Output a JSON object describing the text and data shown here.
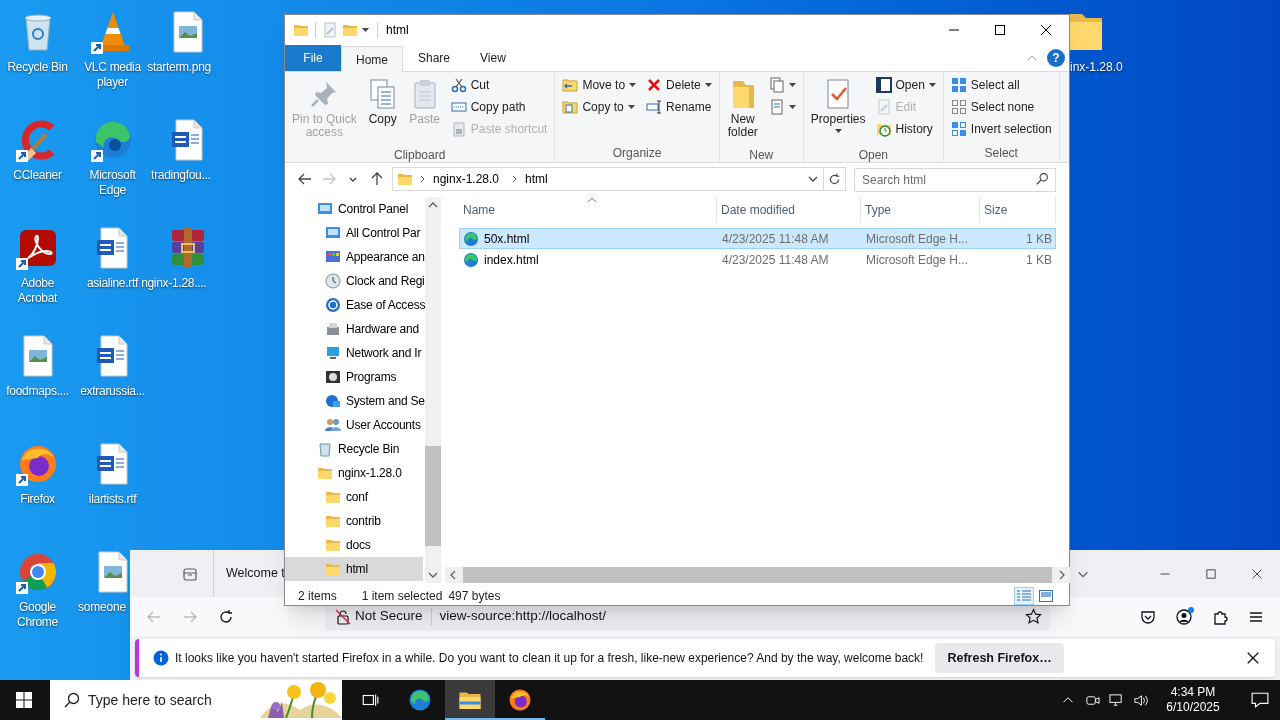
{
  "desktop": {
    "columns": [
      [
        {
          "label": "Recycle Bin",
          "kind": "recycle",
          "shortcut": false
        },
        {
          "label": "CCleaner",
          "kind": "ccleaner",
          "shortcut": true
        },
        {
          "label": "Adobe Acrobat",
          "kind": "acrobat",
          "shortcut": true
        },
        {
          "label": "foodmaps....",
          "kind": "image",
          "shortcut": false
        },
        {
          "label": "Firefox",
          "kind": "firefox",
          "shortcut": true
        },
        {
          "label": "Google Chrome",
          "kind": "chrome",
          "shortcut": true
        }
      ],
      [
        {
          "label": "VLC media player",
          "kind": "vlc",
          "shortcut": true
        },
        {
          "label": "Microsoft Edge",
          "kind": "edge",
          "shortcut": true
        },
        {
          "label": "asialine.rtf",
          "kind": "word",
          "shortcut": false
        },
        {
          "label": "extrarussia...",
          "kind": "word",
          "shortcut": false
        },
        {
          "label": "ilartists.rtf",
          "kind": "word",
          "shortcut": false
        },
        {
          "label": "someone",
          "kind": "image",
          "shortcut": false
        }
      ],
      [
        {
          "label": "starterm.png",
          "kind": "image",
          "shortcut": false
        },
        {
          "label": "tradingfou...",
          "kind": "word",
          "shortcut": false
        },
        {
          "label": "nginx-1.28....",
          "kind": "winrar",
          "shortcut": false
        }
      ]
    ],
    "edge_item": {
      "label": "inx-1.28.0",
      "kind": "folder",
      "shortcut": false
    }
  },
  "explorer": {
    "title": "html",
    "ribbon_tabs": [
      {
        "label": "File",
        "kind": "file",
        "selected": false
      },
      {
        "label": "Home",
        "kind": "tab",
        "selected": true
      },
      {
        "label": "Share",
        "kind": "tab",
        "selected": false
      },
      {
        "label": "View",
        "kind": "tab",
        "selected": false
      }
    ],
    "help": "?",
    "ribbon_groups": [
      {
        "label": "Clipboard",
        "items": [
          {
            "kind": "pin",
            "label": "Pin to Quick\naccess",
            "disabled": true,
            "dropdown": false
          },
          {
            "kind": "copy",
            "label": "Copy",
            "disabled": false,
            "dropdown": false
          },
          {
            "kind": "paste",
            "label": "Paste",
            "disabled": true,
            "dropdown": false
          },
          {
            "kind": "stack",
            "buttons": [
              {
                "label": "Cut",
                "kind": "cut",
                "disabled": false,
                "dropdown": false
              },
              {
                "label": "Copy path",
                "kind": "copypath",
                "disabled": false,
                "dropdown": false
              },
              {
                "label": "Paste shortcut",
                "kind": "pasteshortcut",
                "disabled": true,
                "dropdown": false
              }
            ]
          }
        ]
      },
      {
        "label": "Organize",
        "items": [
          {
            "kind": "stack",
            "buttons": [
              {
                "label": "Move to",
                "kind": "moveto",
                "disabled": false,
                "dropdown": true
              },
              {
                "label": "Copy to",
                "kind": "copyto",
                "disabled": false,
                "dropdown": true
              }
            ]
          },
          {
            "kind": "stack",
            "buttons": [
              {
                "label": "Delete",
                "kind": "delete",
                "disabled": false,
                "dropdown": true
              },
              {
                "label": "Rename",
                "kind": "rename",
                "disabled": false,
                "dropdown": false
              }
            ]
          }
        ]
      },
      {
        "label": "New",
        "items": [
          {
            "kind": "newfolder",
            "label": "New\nfolder",
            "disabled": false,
            "dropdown": false
          },
          {
            "kind": "stack",
            "buttons": [
              {
                "kind": "newitem",
                "disabled": false,
                "dropdown": true
              },
              {
                "kind": "easyaccess",
                "disabled": false,
                "dropdown": true
              }
            ]
          }
        ]
      },
      {
        "label": "Open",
        "items": [
          {
            "kind": "properties",
            "label": "Properties",
            "disabled": false,
            "dropdown": true
          },
          {
            "kind": "stack",
            "buttons": [
              {
                "label": "Open",
                "kind": "open",
                "disabled": false,
                "dropdown": true
              },
              {
                "label": "Edit",
                "kind": "edit",
                "disabled": true,
                "dropdown": false
              },
              {
                "label": "History",
                "kind": "history",
                "disabled": false,
                "dropdown": false
              }
            ]
          }
        ]
      },
      {
        "label": "Select",
        "items": [
          {
            "kind": "stack",
            "buttons": [
              {
                "label": "Select all",
                "kind": "selectall",
                "disabled": false,
                "dropdown": false
              },
              {
                "label": "Select none",
                "kind": "selectnone",
                "disabled": false,
                "dropdown": false
              },
              {
                "label": "Invert selection",
                "kind": "invert",
                "disabled": false,
                "dropdown": false
              }
            ]
          }
        ]
      }
    ],
    "nav_buttons": [
      {
        "kind": "back",
        "disabled": false
      },
      {
        "kind": "forward",
        "disabled": true
      },
      {
        "kind": "recent",
        "disabled": false
      },
      {
        "kind": "up",
        "disabled": false
      }
    ],
    "breadcrumb": [
      "nginx-1.28.0",
      "html"
    ],
    "search": {
      "placeholder": "Search html"
    },
    "nav_tree": [
      {
        "label": "Control Panel",
        "kind": "controlpanel",
        "selected": false,
        "children": [
          {
            "label": "All Control Par",
            "kind": "controlpanel",
            "selected": false
          },
          {
            "label": "Appearance an",
            "kind": "colors",
            "selected": false
          },
          {
            "label": "Clock and Regi",
            "kind": "clock",
            "selected": false
          },
          {
            "label": "Ease of Access",
            "kind": "ease",
            "selected": false
          },
          {
            "label": "Hardware and",
            "kind": "hardware",
            "selected": false
          },
          {
            "label": "Network and Ir",
            "kind": "network",
            "selected": false
          },
          {
            "label": "Programs",
            "kind": "programs",
            "selected": false
          },
          {
            "label": "System and Se",
            "kind": "system",
            "selected": false
          },
          {
            "label": "User Accounts",
            "kind": "users",
            "selected": false
          }
        ]
      },
      {
        "label": "Recycle Bin",
        "kind": "recycle",
        "selected": false
      },
      {
        "label": "nginx-1.28.0",
        "kind": "folder",
        "selected": false,
        "children": [
          {
            "label": "conf",
            "kind": "folder",
            "selected": false
          },
          {
            "label": "contrib",
            "kind": "folder",
            "selected": false
          },
          {
            "label": "docs",
            "kind": "folder",
            "selected": false
          },
          {
            "label": "html",
            "kind": "folder",
            "selected": true
          }
        ]
      }
    ],
    "columns": [
      {
        "label": "Name",
        "sorted": true
      },
      {
        "label": "Date modified",
        "sorted": false
      },
      {
        "label": "Type",
        "sorted": false
      },
      {
        "label": "Size",
        "sorted": false
      }
    ],
    "rows": [
      {
        "name": "50x.html",
        "date": "4/23/2025 11:48 AM",
        "type": "Microsoft Edge H...",
        "size": "1 KB",
        "selected": true
      },
      {
        "name": "index.html",
        "date": "4/23/2025 11:48 AM",
        "type": "Microsoft Edge H...",
        "size": "1 KB",
        "selected": false
      }
    ],
    "status_bar": {
      "items": "2 items",
      "selection": "1 item selected",
      "size": "497 bytes"
    },
    "views": [
      {
        "kind": "details",
        "selected": true
      },
      {
        "kind": "large",
        "selected": false
      }
    ]
  },
  "firefox": {
    "tab": "Welcome t",
    "security": "Not Secure",
    "url": "view-source:http://localhost/",
    "notification": {
      "text": "It looks like you haven't started Firefox in a while. Do you want to clean it up for a fresh, like-new experience? And by the way, welcome back!",
      "button": "Refresh Firefox…"
    }
  },
  "taskbar": {
    "search_placeholder": "Type here to search",
    "apps": [
      {
        "kind": "taskview",
        "active": false,
        "running": false
      },
      {
        "kind": "edge",
        "active": false,
        "running": false
      },
      {
        "kind": "explorer",
        "active": true,
        "running": true
      },
      {
        "kind": "firefox",
        "active": false,
        "running": true
      }
    ],
    "time": "4:34 PM",
    "date": "6/10/2025"
  }
}
